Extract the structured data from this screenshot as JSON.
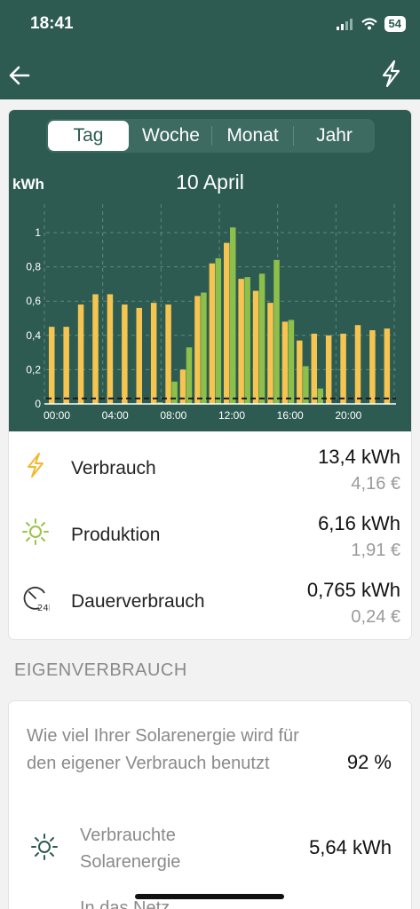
{
  "status": {
    "time": "18:41",
    "battery": "54"
  },
  "header": {
    "back_icon": "arrow-left-icon",
    "action_icon": "lightning-icon"
  },
  "tabs": [
    {
      "label": "Tag",
      "active": true
    },
    {
      "label": "Woche",
      "active": false
    },
    {
      "label": "Monat",
      "active": false
    },
    {
      "label": "Jahr",
      "active": false
    }
  ],
  "chart_data": {
    "type": "bar",
    "title": "10 April",
    "ylabel": "kWh",
    "ylim": [
      0,
      1.05
    ],
    "yticks": [
      "0",
      "0,2",
      "0,4",
      "0,6",
      "0,8",
      "1"
    ],
    "xticks": [
      "00:00",
      "04:00",
      "08:00",
      "12:00",
      "16:00",
      "20:00"
    ],
    "grid": true,
    "colors": {
      "consumption": "#f5c451",
      "production": "#8dc04a",
      "baseline": "#1a1a1a",
      "background": "#2d5b51"
    },
    "series": [
      {
        "key": "consumption",
        "values": [
          0.45,
          0.45,
          0.58,
          0.64,
          0.64,
          0.58,
          0.56,
          0.59,
          0.58,
          0.2,
          0.63,
          0.82,
          0.94,
          0.73,
          0.66,
          0.59,
          0.48,
          0.37,
          0.41,
          0.4,
          0.41,
          0.46,
          0.43,
          0.44
        ]
      },
      {
        "key": "production",
        "values": [
          0,
          0,
          0,
          0,
          0,
          0,
          0,
          0.01,
          0.13,
          0.33,
          0.65,
          0.85,
          1.03,
          0.74,
          0.76,
          0.84,
          0.49,
          0.22,
          0.09,
          0,
          0,
          0,
          0,
          0
        ]
      }
    ],
    "baseline_value": 0.032
  },
  "metrics": [
    {
      "icon": "lightning-icon",
      "label": "Verbrauch",
      "value": "13,4 kWh",
      "cost": "4,16 €"
    },
    {
      "icon": "sun-icon",
      "label": "Produktion",
      "value": "6,16 kWh",
      "cost": "1,91 €"
    },
    {
      "icon": "clock-24h-icon",
      "label": "Dauerverbrauch",
      "value": "0,765 kWh",
      "cost": "0,24 €"
    }
  ],
  "self_consumption": {
    "section_title": "EIGENVERBRAUCH",
    "question": "Wie viel Ihrer Solarenergie wird für den eigener Verbrauch benutzt",
    "percent": "92 %",
    "used_label": "Verbrauchte Solarenergie",
    "used_value": "5,64 kWh",
    "next_label": "In das Netz"
  }
}
